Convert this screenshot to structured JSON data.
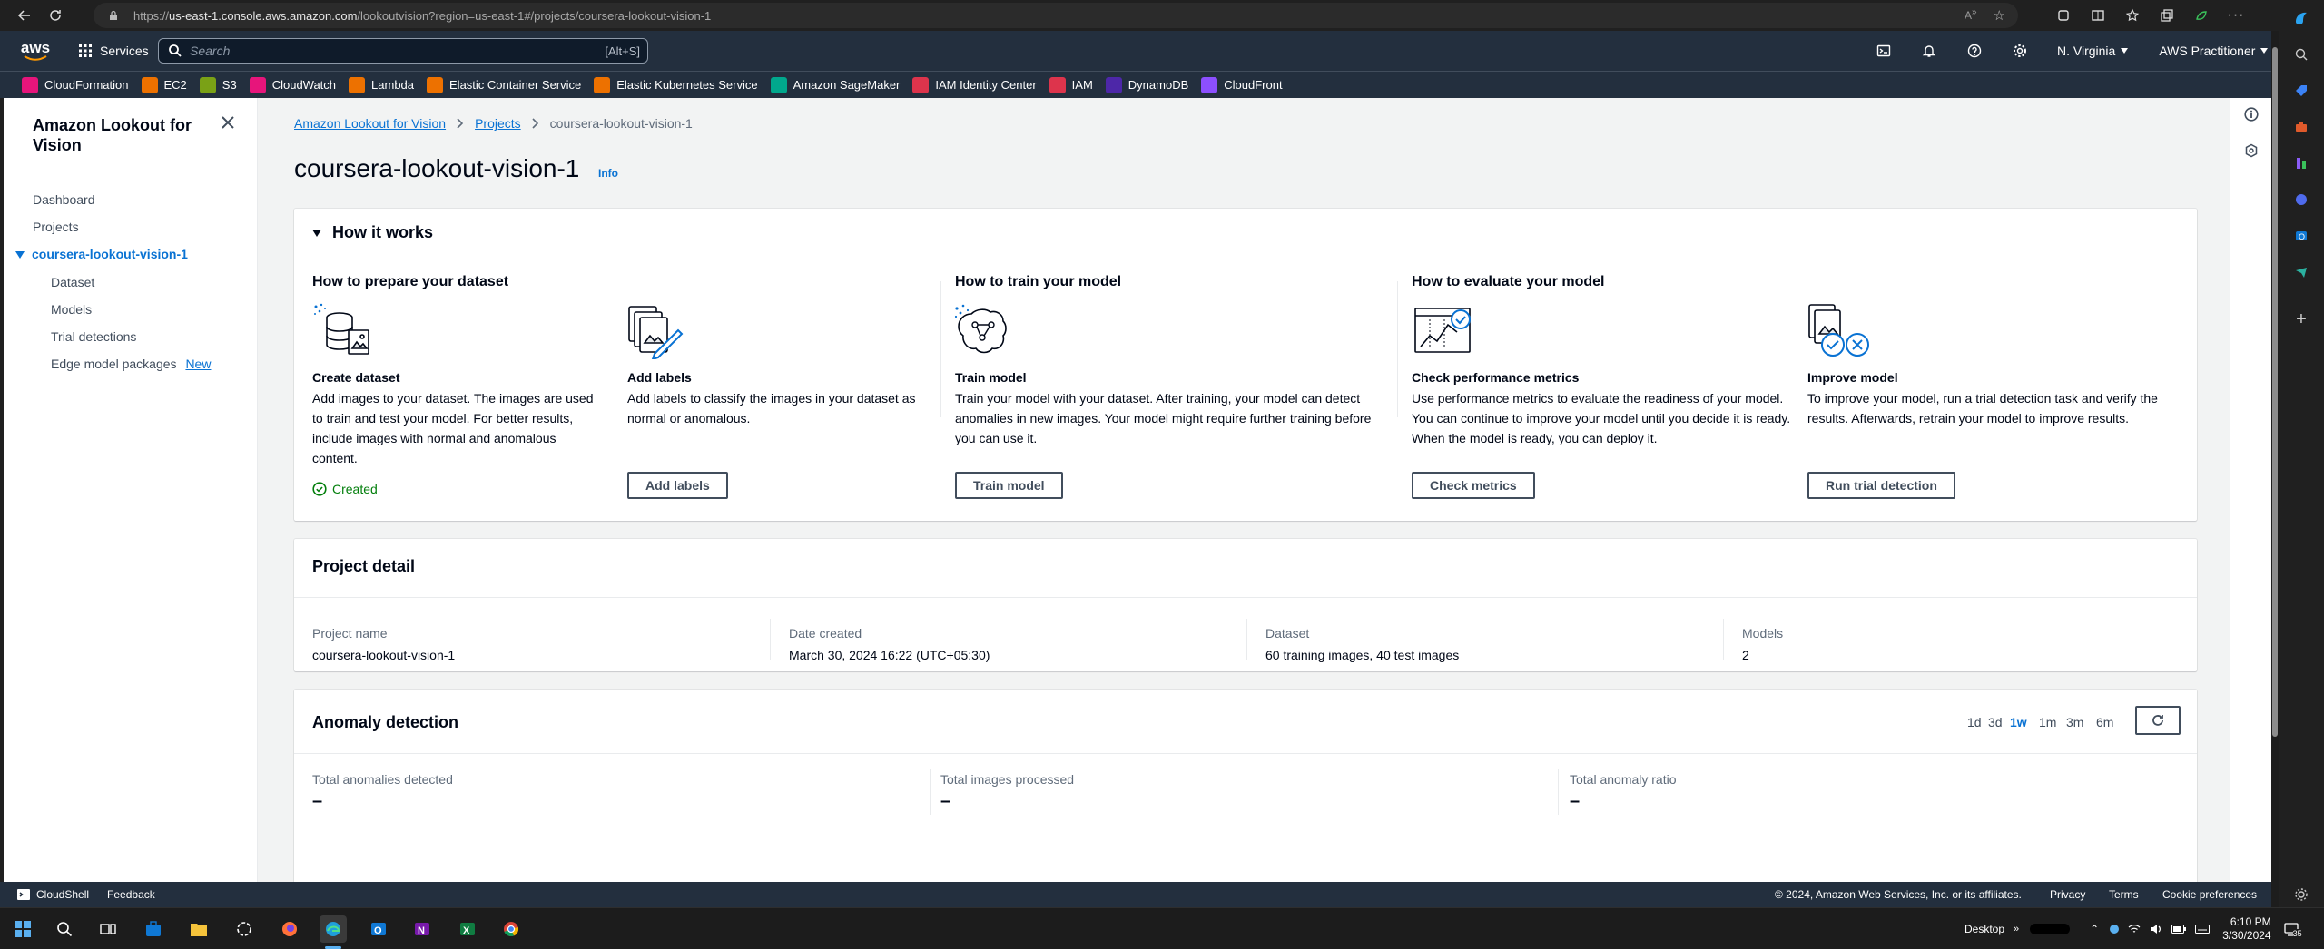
{
  "browser": {
    "url_prefix": "https://",
    "url_host": "us-east-1.console.aws.amazon.com",
    "url_path": "/lookoutvision?region=us-east-1#/projects/coursera-lookout-vision-1"
  },
  "aws_header": {
    "services_label": "Services",
    "search_placeholder": "Search",
    "search_shortcut": "[Alt+S]",
    "region": "N. Virginia",
    "account": "AWS Practitioner"
  },
  "favorites": [
    {
      "label": "CloudFormation",
      "color": "#e7157b"
    },
    {
      "label": "EC2",
      "color": "#ed7100"
    },
    {
      "label": "S3",
      "color": "#7aa116"
    },
    {
      "label": "CloudWatch",
      "color": "#e7157b"
    },
    {
      "label": "Lambda",
      "color": "#ed7100"
    },
    {
      "label": "Elastic Container Service",
      "color": "#ed7100"
    },
    {
      "label": "Elastic Kubernetes Service",
      "color": "#ed7100"
    },
    {
      "label": "Amazon SageMaker",
      "color": "#01a88d"
    },
    {
      "label": "IAM Identity Center",
      "color": "#dd344c"
    },
    {
      "label": "IAM",
      "color": "#dd344c"
    },
    {
      "label": "DynamoDB",
      "color": "#4d27a8"
    },
    {
      "label": "CloudFront",
      "color": "#8c4fff"
    }
  ],
  "sidenav": {
    "title": "Amazon Lookout for Vision",
    "dashboard": "Dashboard",
    "projects": "Projects",
    "project": "coursera-lookout-vision-1",
    "dataset": "Dataset",
    "models": "Models",
    "trial_detections": "Trial detections",
    "edge_model_packages": "Edge model packages",
    "new_badge": "New"
  },
  "breadcrumbs": {
    "root": "Amazon Lookout for Vision",
    "projects": "Projects",
    "current": "coursera-lookout-vision-1"
  },
  "page": {
    "title": "coursera-lookout-vision-1",
    "info": "Info"
  },
  "how_it_works": {
    "header": "How it works",
    "prepare_title": "How to prepare your dataset",
    "train_title": "How to train your model",
    "evaluate_title": "How to evaluate your model",
    "steps": {
      "create": {
        "title": "Create dataset",
        "desc": "Add images to your dataset. The images are used to train and test your model. For better results, include images with normal and anomalous content.",
        "status": "Created"
      },
      "labels": {
        "title": "Add labels",
        "desc": "Add labels to classify the images in your dataset as normal or anomalous.",
        "button": "Add labels"
      },
      "train": {
        "title": "Train model",
        "desc": "Train your model with your dataset. After training, your model can detect anomalies in new images. Your model might require further training before you can use it.",
        "button": "Train model"
      },
      "check": {
        "title": "Check performance metrics",
        "desc": "Use performance metrics to evaluate the readiness of your model. You can continue to improve your model until you decide it is ready. When the model is ready, you can deploy it.",
        "button": "Check metrics"
      },
      "improve": {
        "title": "Improve model",
        "desc": "To improve your model, run a trial detection task and verify the results. Afterwards, retrain your model to improve results.",
        "button": "Run trial detection"
      }
    }
  },
  "project_detail": {
    "header": "Project detail",
    "name_label": "Project name",
    "name_value": "coursera-lookout-vision-1",
    "date_label": "Date created",
    "date_value": "March 30, 2024 16:22 (UTC+05:30)",
    "dataset_label": "Dataset",
    "dataset_value": "60 training images, 40 test images",
    "models_label": "Models",
    "models_value": "2"
  },
  "anomaly_detection": {
    "header": "Anomaly detection",
    "ranges": [
      "1d",
      "3d",
      "1w",
      "1m",
      "3m",
      "6m"
    ],
    "selected_range": "1w",
    "total_anomalies_label": "Total anomalies detected",
    "total_anomalies_value": "–",
    "images_processed_label": "Total images processed",
    "images_processed_value": "–",
    "ratio_label": "Total anomaly ratio",
    "ratio_value": "–"
  },
  "footer": {
    "cloudshell": "CloudShell",
    "feedback": "Feedback",
    "copyright": "© 2024, Amazon Web Services, Inc. or its affiliates.",
    "privacy": "Privacy",
    "terms": "Terms",
    "cookies": "Cookie preferences"
  },
  "taskbar": {
    "desktop_label": "Desktop",
    "time": "6:10 PM",
    "date": "3/30/2024",
    "notification_count": "35"
  },
  "colors": {
    "aws_nav": "#232f3e",
    "link": "#0972d3",
    "success": "#037f0c",
    "page_bg": "#f2f3f3"
  }
}
